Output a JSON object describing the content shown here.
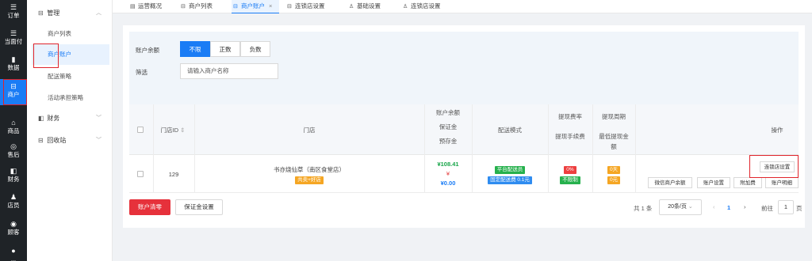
{
  "nav": {
    "items": [
      {
        "icon": "☰",
        "icon_name": "order-icon",
        "label": "订单"
      },
      {
        "icon": "☰",
        "icon_name": "pay-icon",
        "label": "当面付"
      },
      {
        "icon": "▮",
        "icon_name": "chart-icon",
        "label": "数据"
      },
      {
        "icon": "⊟",
        "icon_name": "store-icon",
        "label": "商户"
      },
      {
        "icon": "⌂",
        "icon_name": "goods-icon",
        "label": "商品"
      },
      {
        "icon": "◎",
        "icon_name": "headset-icon",
        "label": "售后"
      },
      {
        "icon": "◧",
        "icon_name": "finance-icon",
        "label": "财务"
      },
      {
        "icon": "♟",
        "icon_name": "clerk-icon",
        "label": "店员"
      },
      {
        "icon": "◉",
        "icon_name": "customer-icon",
        "label": "顾客"
      },
      {
        "icon": "●",
        "icon_name": "more-icon",
        "label": "..."
      }
    ]
  },
  "submenu": {
    "group_manage": "管理",
    "items": [
      "商户列表",
      "商户账户",
      "配送策略",
      "活动承担策略"
    ],
    "group_finance": "财务",
    "group_recycle": "回收站"
  },
  "tabs": [
    {
      "icon": "▤",
      "label": "运营概况"
    },
    {
      "icon": "⊟",
      "label": "商户列表"
    },
    {
      "icon": "⊟",
      "label": "商户账户"
    },
    {
      "icon": "⊟",
      "label": "连锁店设置"
    },
    {
      "icon": "♙",
      "label": "基础设置"
    },
    {
      "icon": "♙",
      "label": "连锁店设置"
    }
  ],
  "filter": {
    "balance_label": "账户余额",
    "options": [
      "不限",
      "正数",
      "负数"
    ],
    "selected": "不限",
    "search_label": "筛选",
    "search_placeholder": "请输入商户名称"
  },
  "table": {
    "headers": {
      "store_id": "门店ID",
      "store": "门店",
      "balance": [
        "账户余额",
        "保证金",
        "预存金"
      ],
      "delivery": "配送模式",
      "fee": [
        "提现费率",
        "提现手续费"
      ],
      "cycle": [
        "提现周期",
        "最低提现金",
        "额"
      ],
      "ops": "操作"
    },
    "rows": [
      {
        "id": "129",
        "name": "书亦烧仙草（南区食堂店）",
        "tag": "共卖+好店",
        "balance": "¥108.41",
        "deposit": "¥",
        "prestore": "¥0.00",
        "delivery_tag": "平台配送员",
        "delivery_sub": "固定配送费 0.1元",
        "fee_rate": "0%",
        "fee_limit": "不限制",
        "cycle": "0天",
        "min_amount": "0元",
        "ops": [
          "连锁店设置",
          "微信商户余额",
          "账户设置",
          "附加费",
          "账户明细"
        ]
      }
    ]
  },
  "footer": {
    "clear_button": "账户清零",
    "deposit_button": "保证金设置",
    "total": "共 1 条",
    "page_size": "20条/页",
    "prev": "‹",
    "page": "1",
    "next": "›",
    "goto_label": "前往",
    "goto_value": "1",
    "page_unit": "页"
  }
}
